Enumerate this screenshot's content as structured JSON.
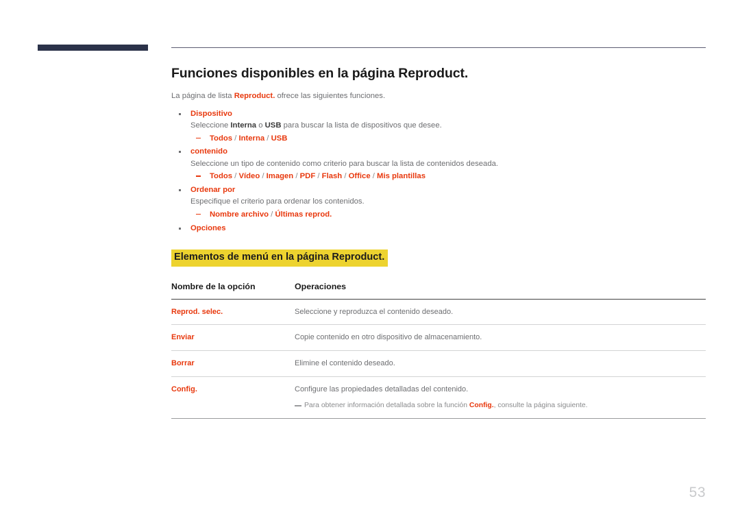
{
  "document": {
    "page_number": "53",
    "title": "Funciones disponibles en la página Reproduct.",
    "intro": {
      "before": "La página de lista ",
      "keyword": "Reproduct.",
      "after": " ofrece las siguientes funciones."
    }
  },
  "colors": {
    "accent_red": "#e8380d",
    "highlight_yellow": "#edd32f",
    "top_bar_navy": "#2b3249",
    "body_gray": "#6d6e71"
  },
  "bullets": [
    {
      "title": "Dispositivo",
      "desc_before": "Seleccione ",
      "desc_kw1": "Interna",
      "desc_mid": " o ",
      "desc_kw2": "USB",
      "desc_after": " para buscar la lista de dispositivos que desee.",
      "options": [
        "Todos",
        "Interna",
        "USB"
      ]
    },
    {
      "title": "contenido",
      "desc_plain": "Seleccione un tipo de contenido como criterio para buscar la lista de contenidos deseada.",
      "options": [
        "Todos",
        "Vídeo",
        "Imagen",
        "PDF",
        "Flash",
        "Office",
        "Mis plantillas"
      ]
    },
    {
      "title": "Ordenar por",
      "desc_plain": "Especifique el criterio para ordenar los contenidos.",
      "options": [
        "Nombre archivo",
        "Últimas reprod."
      ]
    },
    {
      "title": "Opciones",
      "desc_plain": "",
      "options": []
    }
  ],
  "section": {
    "heading": "Elementos de menú en la página Reproduct."
  },
  "table": {
    "headers": [
      "Nombre de la opción",
      "Operaciones"
    ],
    "rows": [
      {
        "name": "Reprod. selec.",
        "operation": "Seleccione y reproduzca el contenido deseado."
      },
      {
        "name": "Enviar",
        "operation": "Copie contenido en otro dispositivo de almacenamiento."
      },
      {
        "name": "Borrar",
        "operation": "Elimine el contenido deseado."
      },
      {
        "name": "Config.",
        "operation": "Configure las propiedades detalladas del contenido.",
        "note_before": "Para obtener información detallada sobre la función ",
        "note_keyword": "Config.",
        "note_after": ", consulte la página siguiente."
      }
    ]
  }
}
